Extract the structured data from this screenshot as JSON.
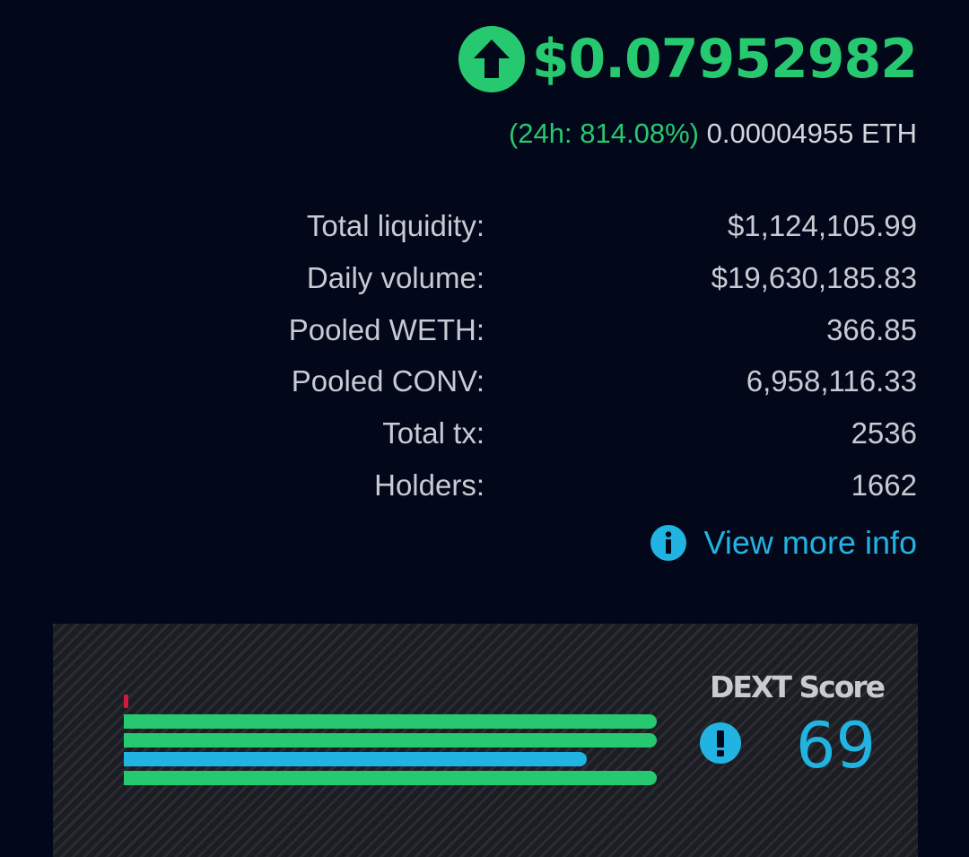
{
  "header": {
    "price": "$0.07952982",
    "change_24h": "(24h: 814.08%)",
    "eth_price": "0.00004955 ETH",
    "trend_icon": "arrow-up-circle-icon",
    "trend_color": "#26c96f"
  },
  "stats": [
    {
      "label": "Total liquidity:",
      "value": "$1,124,105.99"
    },
    {
      "label": "Daily volume:",
      "value": "$19,630,185.83"
    },
    {
      "label": "Pooled WETH:",
      "value": "366.85"
    },
    {
      "label": "Pooled CONV:",
      "value": "6,958,116.33"
    },
    {
      "label": "Total tx:",
      "value": "2536"
    },
    {
      "label": "Holders:",
      "value": "1662"
    }
  ],
  "view_more": {
    "label": "View more info",
    "icon": "info-circle-icon",
    "color": "#21b4e2"
  },
  "score": {
    "title": "DEXT Score",
    "value": "69",
    "warning_icon": "exclamation-circle-icon",
    "bars": [
      {
        "fraction": 0.99,
        "color": "#26c96f"
      },
      {
        "fraction": 0.99,
        "color": "#26c96f"
      },
      {
        "fraction": 0.86,
        "color": "#21b4e2"
      },
      {
        "fraction": 0.99,
        "color": "#26c96f"
      }
    ],
    "marker_color": "#d21a3c"
  }
}
